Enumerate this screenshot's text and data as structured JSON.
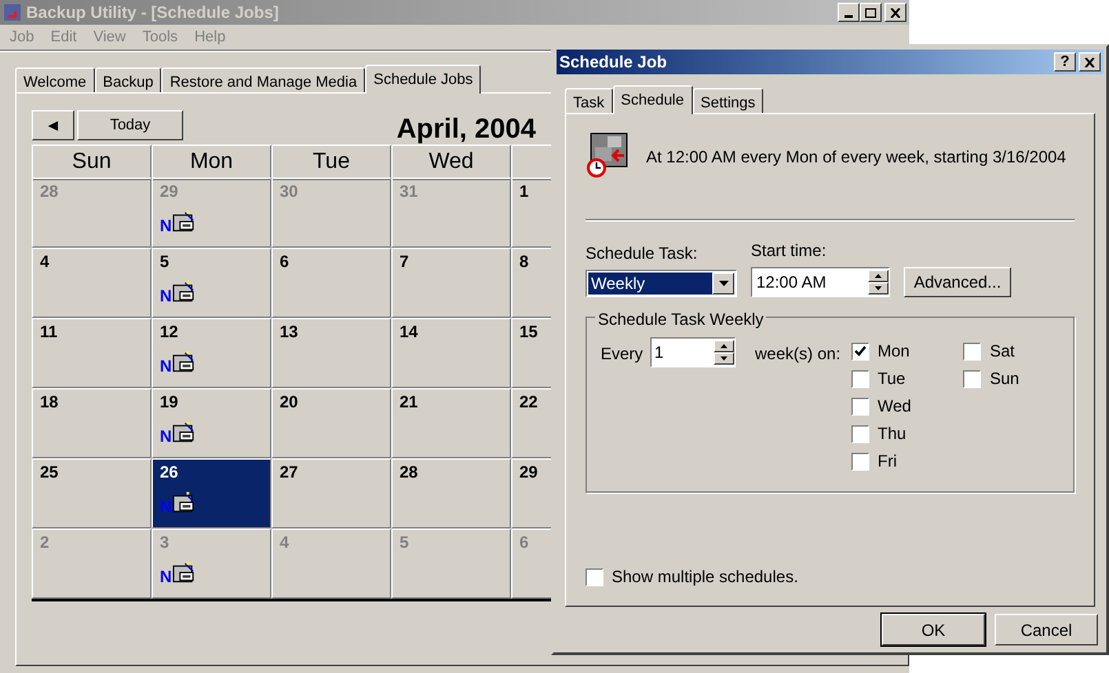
{
  "app": {
    "title": "Backup Utility - [Schedule Jobs]",
    "menu": [
      "Job",
      "Edit",
      "View",
      "Tools",
      "Help"
    ],
    "tabs": [
      {
        "label": "Welcome",
        "selected": false
      },
      {
        "label": "Backup",
        "selected": false
      },
      {
        "label": "Restore and Manage Media",
        "selected": false
      },
      {
        "label": "Schedule Jobs",
        "selected": true
      }
    ],
    "calendar": {
      "prev_button": "◄",
      "today_button": "Today",
      "month": "April, 2004",
      "columns": [
        "Sun",
        "Mon",
        "Tue",
        "Wed"
      ],
      "weeks": [
        [
          {
            "day": "28",
            "other_month": true,
            "selected": false
          },
          {
            "day": "29",
            "other_month": true,
            "job_badge": "N",
            "selected": false
          },
          {
            "day": "30",
            "other_month": true,
            "selected": false
          },
          {
            "day": "31",
            "other_month": true,
            "selected": false
          },
          {
            "day": "1",
            "other_month": false,
            "selected": false
          }
        ],
        [
          {
            "day": "4",
            "other_month": false,
            "selected": false
          },
          {
            "day": "5",
            "other_month": false,
            "job_badge": "N",
            "selected": false
          },
          {
            "day": "6",
            "other_month": false,
            "selected": false
          },
          {
            "day": "7",
            "other_month": false,
            "selected": false
          },
          {
            "day": "8",
            "other_month": false,
            "selected": false
          }
        ],
        [
          {
            "day": "11",
            "other_month": false,
            "selected": false
          },
          {
            "day": "12",
            "other_month": false,
            "job_badge": "N",
            "selected": false
          },
          {
            "day": "13",
            "other_month": false,
            "selected": false
          },
          {
            "day": "14",
            "other_month": false,
            "selected": false
          },
          {
            "day": "15",
            "other_month": false,
            "selected": false
          }
        ],
        [
          {
            "day": "18",
            "other_month": false,
            "selected": false
          },
          {
            "day": "19",
            "other_month": false,
            "job_badge": "N",
            "selected": false
          },
          {
            "day": "20",
            "other_month": false,
            "selected": false
          },
          {
            "day": "21",
            "other_month": false,
            "selected": false
          },
          {
            "day": "22",
            "other_month": false,
            "selected": false
          }
        ],
        [
          {
            "day": "25",
            "other_month": false,
            "selected": false
          },
          {
            "day": "26",
            "other_month": false,
            "job_badge": "N",
            "selected": true
          },
          {
            "day": "27",
            "other_month": false,
            "selected": false
          },
          {
            "day": "28",
            "other_month": false,
            "selected": false
          },
          {
            "day": "29",
            "other_month": false,
            "selected": false
          }
        ],
        [
          {
            "day": "2",
            "other_month": true,
            "selected": false
          },
          {
            "day": "3",
            "other_month": true,
            "job_badge": "N",
            "selected": false
          },
          {
            "day": "4",
            "other_month": true,
            "selected": false
          },
          {
            "day": "5",
            "other_month": true,
            "selected": false
          },
          {
            "day": "6",
            "other_month": true,
            "selected": false
          }
        ]
      ]
    }
  },
  "dialog": {
    "title": "Schedule Job",
    "help_button": "?",
    "tabs": [
      {
        "label": "Task",
        "selected": false
      },
      {
        "label": "Schedule",
        "selected": true
      },
      {
        "label": "Settings",
        "selected": false
      }
    ],
    "summary": "At 12:00 AM every Mon of every week, starting 3/16/2004",
    "schedule_task": {
      "label": "Schedule Task:",
      "value": "Weekly"
    },
    "start_time": {
      "label": "Start time:",
      "value": "12:00 AM"
    },
    "advanced_button": "Advanced...",
    "group": {
      "title": "Schedule Task Weekly",
      "every_label": "Every",
      "every_value": "1",
      "weeks_label": "week(s) on:",
      "days": [
        {
          "label": "Mon",
          "checked": true
        },
        {
          "label": "Tue",
          "checked": false
        },
        {
          "label": "Wed",
          "checked": false
        },
        {
          "label": "Thu",
          "checked": false
        },
        {
          "label": "Fri",
          "checked": false
        },
        {
          "label": "Sat",
          "checked": false
        },
        {
          "label": "Sun",
          "checked": false
        }
      ]
    },
    "show_multiple": {
      "label": "Show multiple schedules.",
      "checked": false
    },
    "buttons": [
      "OK",
      "Cancel"
    ]
  }
}
